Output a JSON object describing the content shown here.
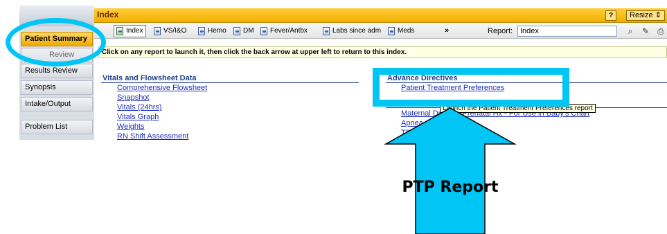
{
  "sidebar": {
    "items": [
      {
        "label": "Patient Summary",
        "active": true
      },
      {
        "label": "Review",
        "active": false
      },
      {
        "label": "Results Review",
        "active": false
      },
      {
        "label": "Synopsis",
        "active": false
      },
      {
        "label": "Intake/Output",
        "active": false
      },
      {
        "label": "Problem List",
        "active": false
      }
    ]
  },
  "header": {
    "title": "Index",
    "help_label": "?",
    "resize_label": "Resize"
  },
  "toolbar": {
    "buttons": [
      "Index",
      "VS/I&O",
      "Hemo",
      "DM",
      "Fever/Antbx",
      "Labs since adm",
      "Meds"
    ],
    "more_label": "»",
    "report_label": "Report:",
    "report_value": "Index"
  },
  "info_text": "Click on any report to launch it, then click the back arrow at upper left to return to this index.",
  "vitals": {
    "heading": "Vitals and Flowsheet Data",
    "links": [
      "Comprehensive Flowsheet",
      "Snapshot",
      "Vitals (24hrs)",
      "Vitals Graph",
      "Weights",
      "RN Shift Assessment"
    ]
  },
  "advance_directives": {
    "heading": "Advance Directives",
    "links": [
      "Patient Treatment Preferences"
    ]
  },
  "other_links": [
    "Maternal Delivery/Prenatal Hx - For Use in Baby's Chart",
    "Apnea",
    "TPN History"
  ],
  "tooltip_text": "Launch the Patient Treatment Preferences report",
  "annotation": {
    "callout_label": "PTP Report",
    "color": "#00c5f5"
  },
  "colors": {
    "accent": "#f2ae00",
    "link": "#1f2fb7",
    "heading": "#1d3f8f"
  }
}
